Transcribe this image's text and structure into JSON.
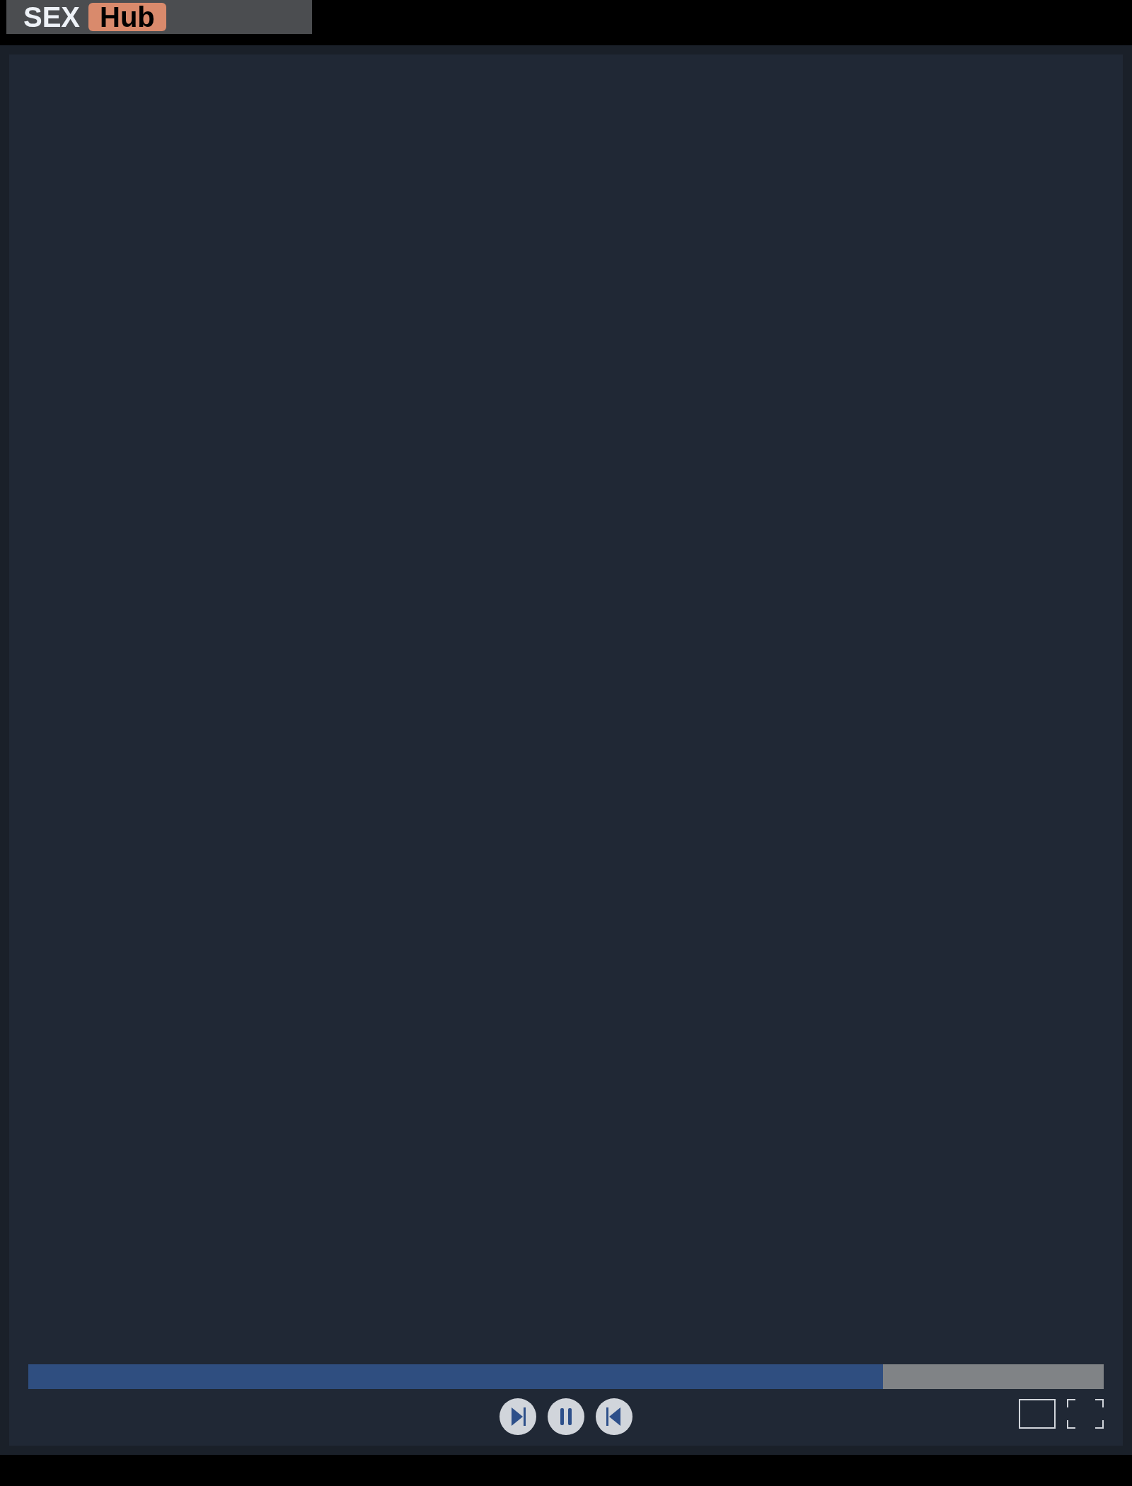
{
  "logo": {
    "word": "SEX",
    "badge": "Hub"
  },
  "player": {
    "progress": {
      "level": 0.795
    },
    "controls": [
      {
        "kind": "next"
      },
      {
        "kind": "pause"
      },
      {
        "kind": "previous"
      }
    ],
    "view_buttons": [
      {
        "kind": "theater"
      },
      {
        "kind": "fullscreen"
      }
    ]
  }
}
